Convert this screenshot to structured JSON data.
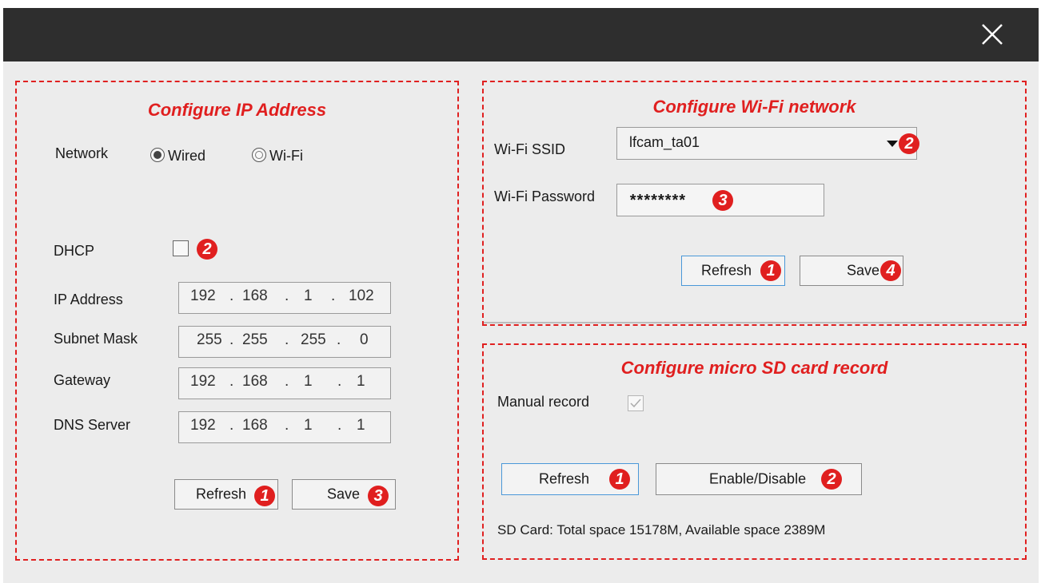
{
  "window": {
    "close_glyph": "✕"
  },
  "ip_panel": {
    "title": "Configure IP Address",
    "network_label": "Network",
    "network_options": [
      "Wired",
      "Wi-Fi"
    ],
    "network_selected": "Wired",
    "dhcp_label": "DHCP",
    "dhcp_checked": false,
    "dhcp_badge": "2",
    "fields": [
      {
        "label": "IP Address",
        "octets": [
          "192",
          "168",
          "1",
          "102"
        ]
      },
      {
        "label": "Subnet Mask",
        "octets": [
          "255",
          "255",
          "255",
          "0"
        ]
      },
      {
        "label": "Gateway",
        "octets": [
          "192",
          "168",
          "1",
          "1"
        ]
      },
      {
        "label": "DNS Server",
        "octets": [
          "192",
          "168",
          "1",
          "1"
        ]
      }
    ],
    "dot": ".",
    "refresh_label": "Refresh",
    "refresh_badge": "1",
    "save_label": "Save",
    "save_badge": "3"
  },
  "wifi_panel": {
    "title": "Configure Wi-Fi network",
    "ssid_label": "Wi-Fi SSID",
    "ssid_value": "lfcam_ta01",
    "ssid_badge": "2",
    "password_label": "Wi-Fi Password",
    "password_value": "********",
    "password_badge": "3",
    "refresh_label": "Refresh",
    "refresh_badge": "1",
    "save_label": "Save",
    "save_badge": "4"
  },
  "sd_panel": {
    "title": "Configure micro SD card record",
    "manual_label": "Manual record",
    "manual_checked": true,
    "refresh_label": "Refresh",
    "refresh_badge": "1",
    "toggle_label": "Enable/Disable",
    "toggle_badge": "2",
    "status": "SD Card: Total space 15178M, Available space 2389M"
  },
  "colors": {
    "accent_red": "#e01f1f",
    "titlebar": "#2e2e2e",
    "focus_blue": "#4a98d8"
  }
}
